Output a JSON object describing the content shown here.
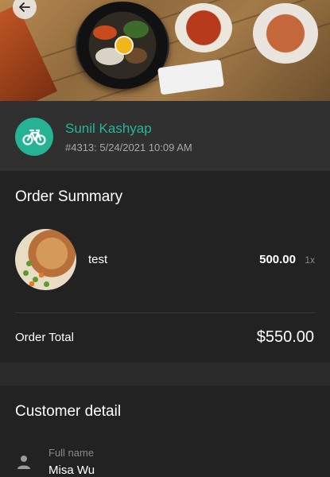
{
  "store": {
    "name": "Sunil Kashyap",
    "meta": "#4313: 5/24/2021 10:09 AM",
    "logo_icon": "bicycle-icon"
  },
  "summary": {
    "title": "Order Summary",
    "items": [
      {
        "name": "test",
        "price": "500.00",
        "qty": "1x"
      }
    ],
    "total_label": "Order Total",
    "total_value": "$550.00"
  },
  "customer": {
    "title": "Customer detail",
    "fields": [
      {
        "label": "Full name",
        "value": "Misa Wu",
        "icon": "person-icon"
      }
    ]
  },
  "colors": {
    "accent": "#27b596",
    "background": "#2a2a2a",
    "card": "#222222"
  },
  "icons": {
    "back": "arrow-left-icon"
  }
}
